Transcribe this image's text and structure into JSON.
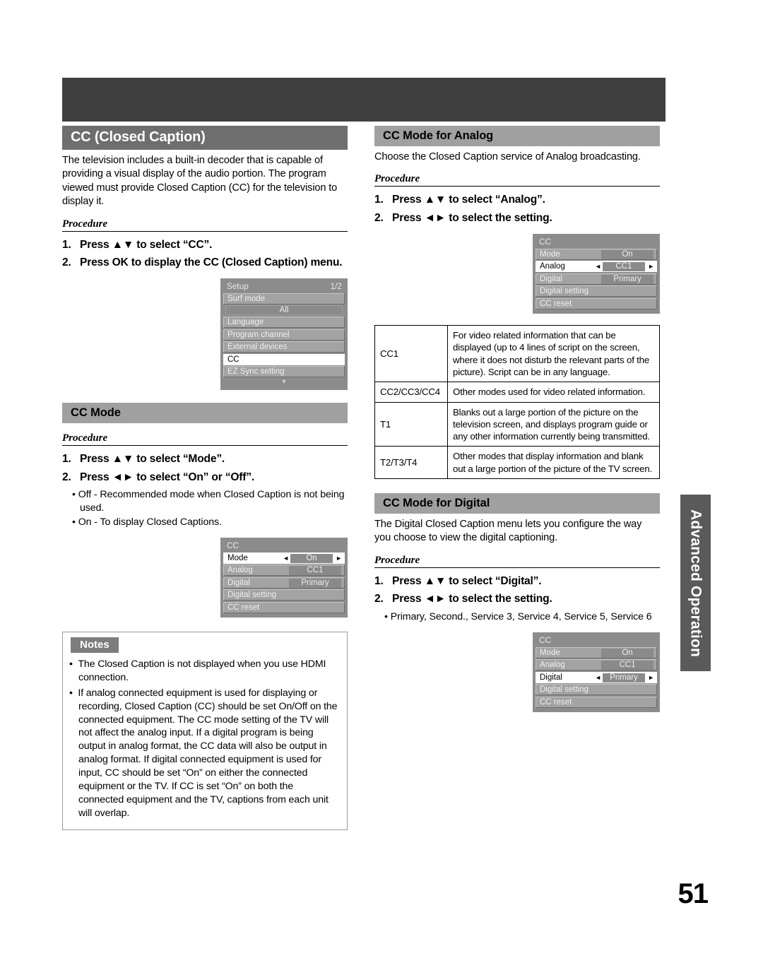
{
  "colors": {
    "banner": "#3f3f3f",
    "main_heading_bg": "#6e6e6e",
    "section_heading_bg": "#a0a0a0",
    "osd_bg": "#8c8c8c",
    "side_tab_bg": "#5a5a5a"
  },
  "page_number": "51",
  "side_tab": {
    "label": "Advanced Operation"
  },
  "left_column": {
    "cc_section": {
      "heading": "CC (Closed Caption)",
      "body": "The television includes a built-in decoder that is capable of providing a visual display of the audio portion. The program viewed must provide Closed Caption (CC) for the television to display it.",
      "procedure_label": "Procedure",
      "steps": [
        {
          "num": "1.",
          "text": "Press ▲▼ to select “CC”."
        },
        {
          "num": "2.",
          "text": "Press OK to display the CC (Closed Caption) menu."
        }
      ],
      "setup_menu": {
        "title": "Setup",
        "page": "1/2",
        "rows": [
          {
            "label": "Surf mode",
            "value": "All",
            "type": "with-sub"
          },
          {
            "label": "Language",
            "type": "plain"
          },
          {
            "label": "Program channel",
            "type": "plain"
          },
          {
            "label": "External devices",
            "type": "plain"
          },
          {
            "label": "CC",
            "type": "selected"
          },
          {
            "label": "EZ Sync setting",
            "type": "plain"
          }
        ],
        "scroll_indicator": "▼"
      }
    },
    "cc_mode_section": {
      "heading": "CC Mode",
      "procedure_label": "Procedure",
      "steps": [
        {
          "num": "1.",
          "text": "Press ▲▼ to select “Mode”."
        },
        {
          "num": "2.",
          "text": "Press ◄► to select “On” or “Off”."
        }
      ],
      "bullets": [
        "Off - Recommended mode when Closed Caption is not being used.",
        "On - To display Closed Captions."
      ],
      "cc_menu": {
        "title": "CC",
        "rows": [
          {
            "label": "Mode",
            "value": "On",
            "selected": true
          },
          {
            "label": "Analog",
            "value": "CC1",
            "selected": false
          },
          {
            "label": "Digital",
            "value": "Primary",
            "selected": false
          },
          {
            "label": "Digital setting",
            "value": "",
            "selected": false
          },
          {
            "label": "CC reset",
            "value": "",
            "selected": false
          }
        ]
      }
    },
    "notes": {
      "tag": "Notes",
      "items": [
        "The Closed Caption is not displayed when you use HDMI connection.",
        "If analog connected equipment is used for displaying or recording, Closed Caption (CC) should be set On/Off on the connected equipment. The CC mode setting of the TV will not affect the analog input. If a digital program is being output in analog format, the CC data will also be output in analog format. If digital connected equipment is used for input, CC should be set “On” on either the connected equipment or the TV. If CC is set “On” on both the connected equipment and the TV, captions from each unit will overlap."
      ]
    }
  },
  "right_column": {
    "analog_section": {
      "heading": "CC Mode for Analog",
      "body": "Choose the Closed Caption service of Analog broadcasting.",
      "procedure_label": "Procedure",
      "steps": [
        {
          "num": "1.",
          "text": "Press ▲▼ to select “Analog”."
        },
        {
          "num": "2.",
          "text": "Press ◄► to select the setting."
        }
      ],
      "cc_menu": {
        "title": "CC",
        "rows": [
          {
            "label": "Mode",
            "value": "On",
            "selected": false
          },
          {
            "label": "Analog",
            "value": "CC1",
            "selected": true
          },
          {
            "label": "Digital",
            "value": "Primary",
            "selected": false
          },
          {
            "label": "Digital setting",
            "value": "",
            "selected": false
          },
          {
            "label": "CC reset",
            "value": "",
            "selected": false
          }
        ]
      }
    },
    "service_table": {
      "rows": [
        {
          "key": "CC1",
          "desc": "For video related information that can be displayed (up to 4 lines of script on the screen, where it does not disturb the relevant parts of the picture). Script can be in any language."
        },
        {
          "key": "CC2/CC3/CC4",
          "desc": "Other modes used for video related information."
        },
        {
          "key": "T1",
          "desc": "Blanks out a large portion of the picture on the television screen, and displays program guide or any other information currently being transmitted."
        },
        {
          "key": "T2/T3/T4",
          "desc": "Other modes that display information and blank out a large portion of the picture of the TV screen."
        }
      ]
    },
    "digital_section": {
      "heading": "CC Mode for Digital",
      "body": "The Digital Closed Caption menu lets you configure the way you choose to view the digital captioning.",
      "procedure_label": "Procedure",
      "steps": [
        {
          "num": "1.",
          "text": "Press ▲▼ to select “Digital”."
        },
        {
          "num": "2.",
          "text": "Press ◄► to select the setting."
        }
      ],
      "bullets": [
        "Primary, Second., Service 3, Service 4, Service 5, Service 6"
      ],
      "cc_menu": {
        "title": "CC",
        "rows": [
          {
            "label": "Mode",
            "value": "On",
            "selected": false
          },
          {
            "label": "Analog",
            "value": "CC1",
            "selected": false
          },
          {
            "label": "Digital",
            "value": "Primary",
            "selected": true
          },
          {
            "label": "Digital setting",
            "value": "",
            "selected": false
          },
          {
            "label": "CC reset",
            "value": "",
            "selected": false
          }
        ]
      }
    }
  }
}
